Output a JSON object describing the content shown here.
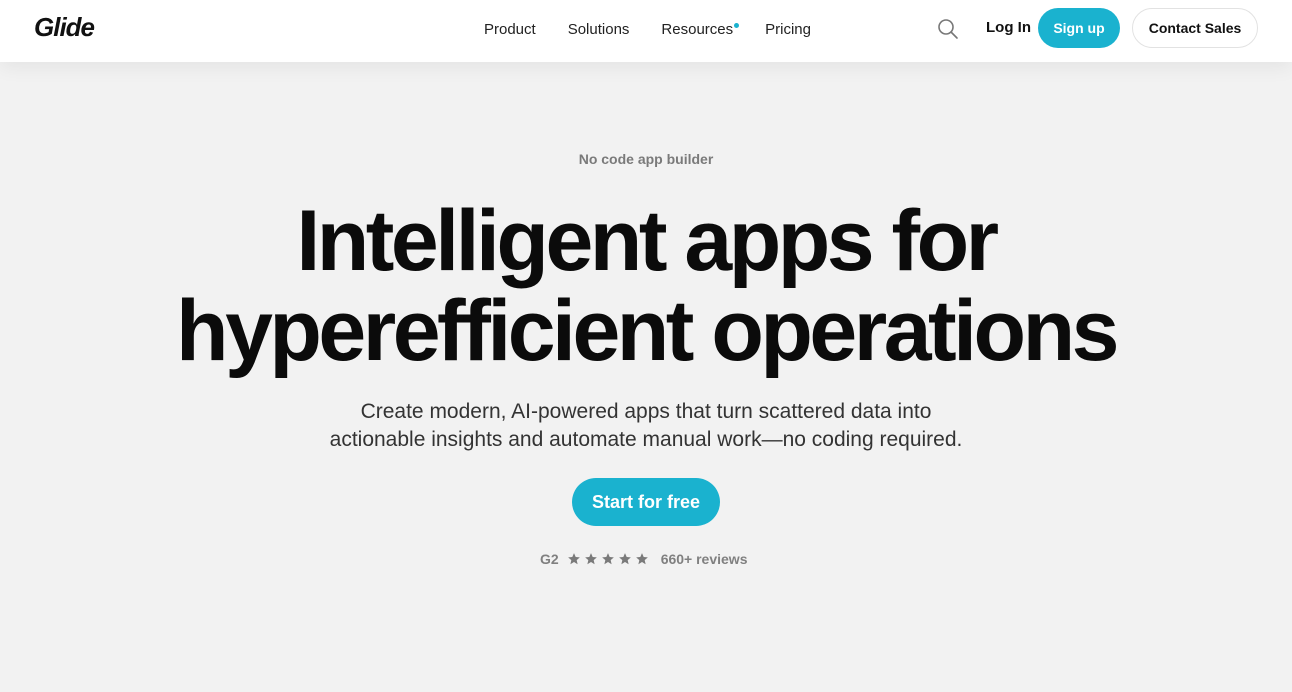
{
  "brand": {
    "logo_text": "Glide"
  },
  "nav": {
    "items": [
      {
        "label": "Product"
      },
      {
        "label": "Solutions"
      },
      {
        "label": "Resources"
      },
      {
        "label": "Pricing"
      }
    ]
  },
  "header_actions": {
    "search_icon": "search-icon",
    "login_label": "Log In",
    "signup_label": "Sign up",
    "contact_label": "Contact Sales"
  },
  "hero": {
    "eyebrow": "No code app builder",
    "headline_line1": "Intelligent apps for",
    "headline_line2": "hyperefficient operations",
    "subtext_line1": "Create modern, AI-powered apps that turn scattered data into",
    "subtext_line2": "actionable insights and automate manual work—no coding required.",
    "cta_label": "Start for free"
  },
  "rating": {
    "source": "G2",
    "stars": 5,
    "reviews_label": "660+ reviews"
  },
  "colors": {
    "accent": "#1ab2cf",
    "background": "#f2f2f2",
    "header": "#ffffff"
  }
}
